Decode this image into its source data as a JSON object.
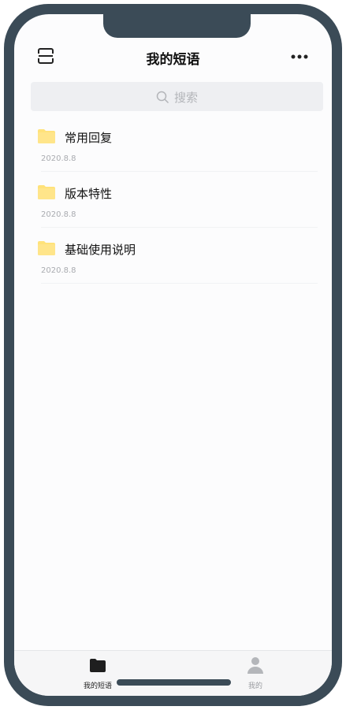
{
  "header": {
    "title": "我的短语"
  },
  "search": {
    "placeholder": "搜索"
  },
  "items": [
    {
      "title": "常用回复",
      "date": "2020.8.8"
    },
    {
      "title": "版本特性",
      "date": "2020.8.8"
    },
    {
      "title": "基础使用说明",
      "date": "2020.8.8"
    }
  ],
  "tabbar": {
    "tabs": [
      {
        "label": "我的短语",
        "icon": "folder-icon",
        "active": true
      },
      {
        "label": "我的",
        "icon": "person-icon",
        "active": false
      }
    ]
  },
  "colors": {
    "frame": "#3b4b57",
    "folder": "#ffe27a",
    "search_bg": "#eeeff2"
  }
}
